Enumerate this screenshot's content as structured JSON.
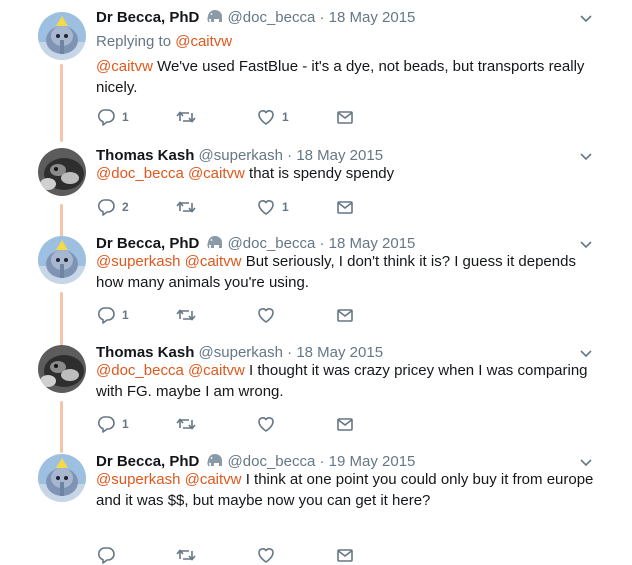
{
  "tweets": [
    {
      "author": "Dr Becca, PhD",
      "handle": "@doc_becca",
      "date": "18 May 2015",
      "has_emoji": true,
      "avatar": "becca",
      "replying_prefix": "Replying to",
      "replying_to": "@caitvw",
      "mentions": "@caitvw",
      "text": "We've used FastBlue - it's a dye, not beads, but transports really nicely.",
      "reply_count": "1",
      "retweet_count": "",
      "like_count": "1"
    },
    {
      "author": "Thomas Kash",
      "handle": "@superkash",
      "date": "18 May 2015",
      "has_emoji": false,
      "avatar": "thomas",
      "mentions": "@doc_becca @caitvw",
      "text": "that is spendy spendy",
      "reply_count": "2",
      "retweet_count": "",
      "like_count": "1"
    },
    {
      "author": "Dr Becca, PhD",
      "handle": "@doc_becca",
      "date": "18 May 2015",
      "has_emoji": true,
      "avatar": "becca",
      "mentions": "@superkash @caitvw",
      "text": "But seriously, I don't think it is? I guess it depends how many animals you're using.",
      "reply_count": "1",
      "retweet_count": "",
      "like_count": ""
    },
    {
      "author": "Thomas Kash",
      "handle": "@superkash",
      "date": "18 May 2015",
      "has_emoji": false,
      "avatar": "thomas",
      "mentions": "@doc_becca @caitvw",
      "text": "I thought it was crazy pricey when I was comparing with FG. maybe I am wrong.",
      "reply_count": "1",
      "retweet_count": "",
      "like_count": ""
    },
    {
      "author": "Dr Becca, PhD",
      "handle": "@doc_becca",
      "date": "19 May 2015",
      "has_emoji": true,
      "avatar": "becca",
      "mentions": "@superkash @caitvw",
      "text": "I think at one point you could only buy it from europe and it was $$, but maybe now you can get it here?",
      "reply_count": "",
      "retweet_count": "",
      "like_count": ""
    }
  ],
  "separator": "·",
  "icons": {
    "reply": "reply-icon",
    "retweet": "retweet-icon",
    "like": "heart-icon",
    "dm": "envelope-icon",
    "more": "chevron-down-icon",
    "emoji": "elephant-icon"
  },
  "colors": {
    "mention": "#e0581c",
    "thread_line": "#f5c5a8",
    "muted": "#657786"
  }
}
